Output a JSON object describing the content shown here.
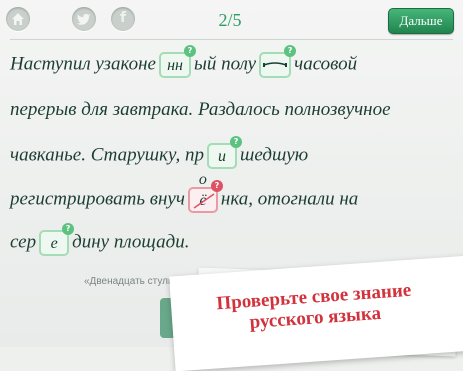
{
  "toolbar": {
    "home_icon": "home-icon",
    "twitter_icon": "twitter-icon",
    "facebook_icon": "facebook-icon",
    "facebook_glyph": "f",
    "counter": "2/5",
    "next_label": "Дальше"
  },
  "exercise": {
    "line1": {
      "before": "Наступил узаконе",
      "gap1": "нн",
      "mid": "ый полу",
      "after": "часовой"
    },
    "line2": {
      "text": "перерыв для завтрака. Раздалось полнозвучное"
    },
    "line3": {
      "before": "чавканье. Старушку, пр",
      "gap": "и",
      "after": "шедшую"
    },
    "line4": {
      "before": "регистрировать внуч",
      "gap_wrong": "ё",
      "correction": "о",
      "after": "нка, отогнали на"
    },
    "line5": {
      "before": "сер",
      "gap": "е",
      "after": "дину площади."
    }
  },
  "source": "«Двенадцать стульев»",
  "promo": {
    "line1": "Проверьте свое знание",
    "line2": "русского языка"
  },
  "colors": {
    "accent": "#2f9a62",
    "gap_border": "#a3dcb6",
    "wrong": "#e05263",
    "promo_text": "#d1323c"
  }
}
